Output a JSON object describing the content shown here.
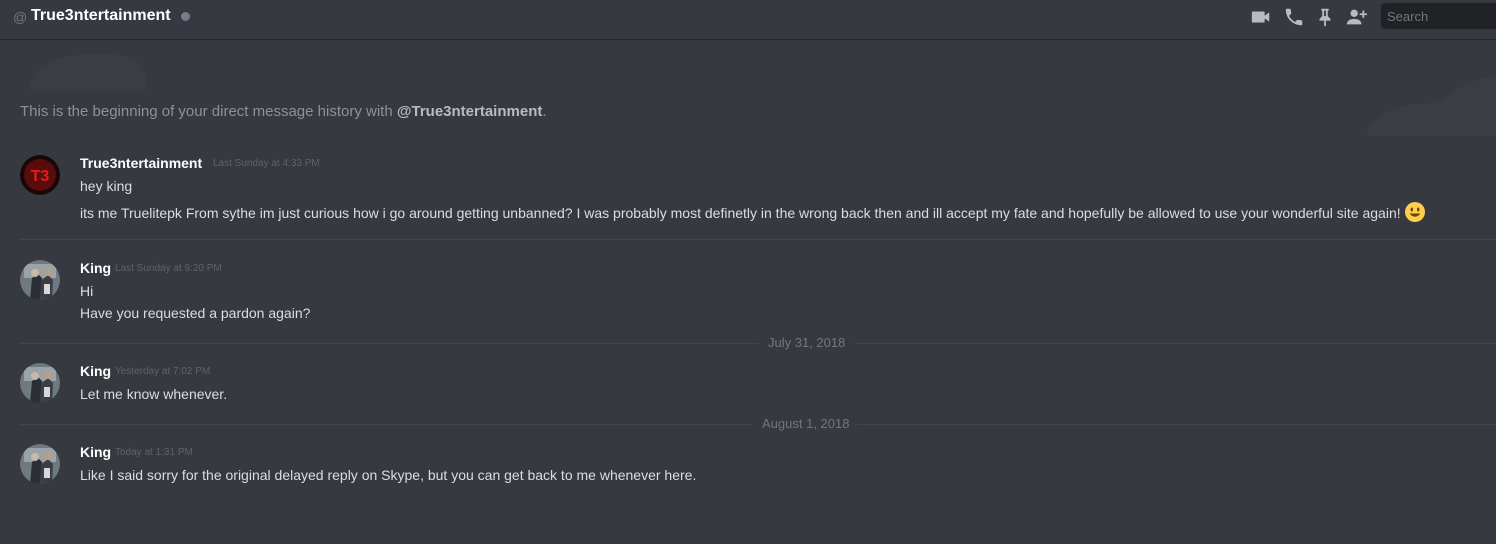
{
  "header": {
    "at_symbol": "@",
    "channel_name": "True3ntertainment",
    "search_placeholder": "Search",
    "icons": [
      "video-icon",
      "phone-icon",
      "pin-icon",
      "add-friend-icon"
    ]
  },
  "intro": {
    "prefix": "This is the beginning of your direct message history with ",
    "mention": "@True3ntertainment",
    "suffix": "."
  },
  "messages": [
    {
      "author": "True3ntertainment",
      "timestamp": "Last Sunday at 4:33 PM",
      "lines": [
        "hey king",
        "its me Truelitepk From sythe im just curious how i go around getting unbanned? I was probably most definetly in the wrong back then and ill accept my fate and hopefully be allowed to use your wonderful site again!"
      ],
      "avatar_text": "T3"
    },
    {
      "author": "King",
      "timestamp": "Last Sunday at 9:20 PM",
      "lines": [
        "Hi",
        "Have you requested a pardon again?"
      ]
    },
    {
      "author": "King",
      "timestamp": "Yesterday at 7:02 PM",
      "lines": [
        "Let me know whenever."
      ]
    },
    {
      "author": "King",
      "timestamp": "Today at 1:31 PM",
      "lines": [
        "Like I said sorry for the original delayed reply on Skype, but you can get back to me whenever here."
      ]
    }
  ],
  "date_dividers": [
    "July 31, 2018",
    "August 1, 2018"
  ],
  "colors": {
    "background": "#36393f",
    "text": "#dcddde",
    "muted": "#72767d",
    "status_offline": "#747f8d"
  }
}
